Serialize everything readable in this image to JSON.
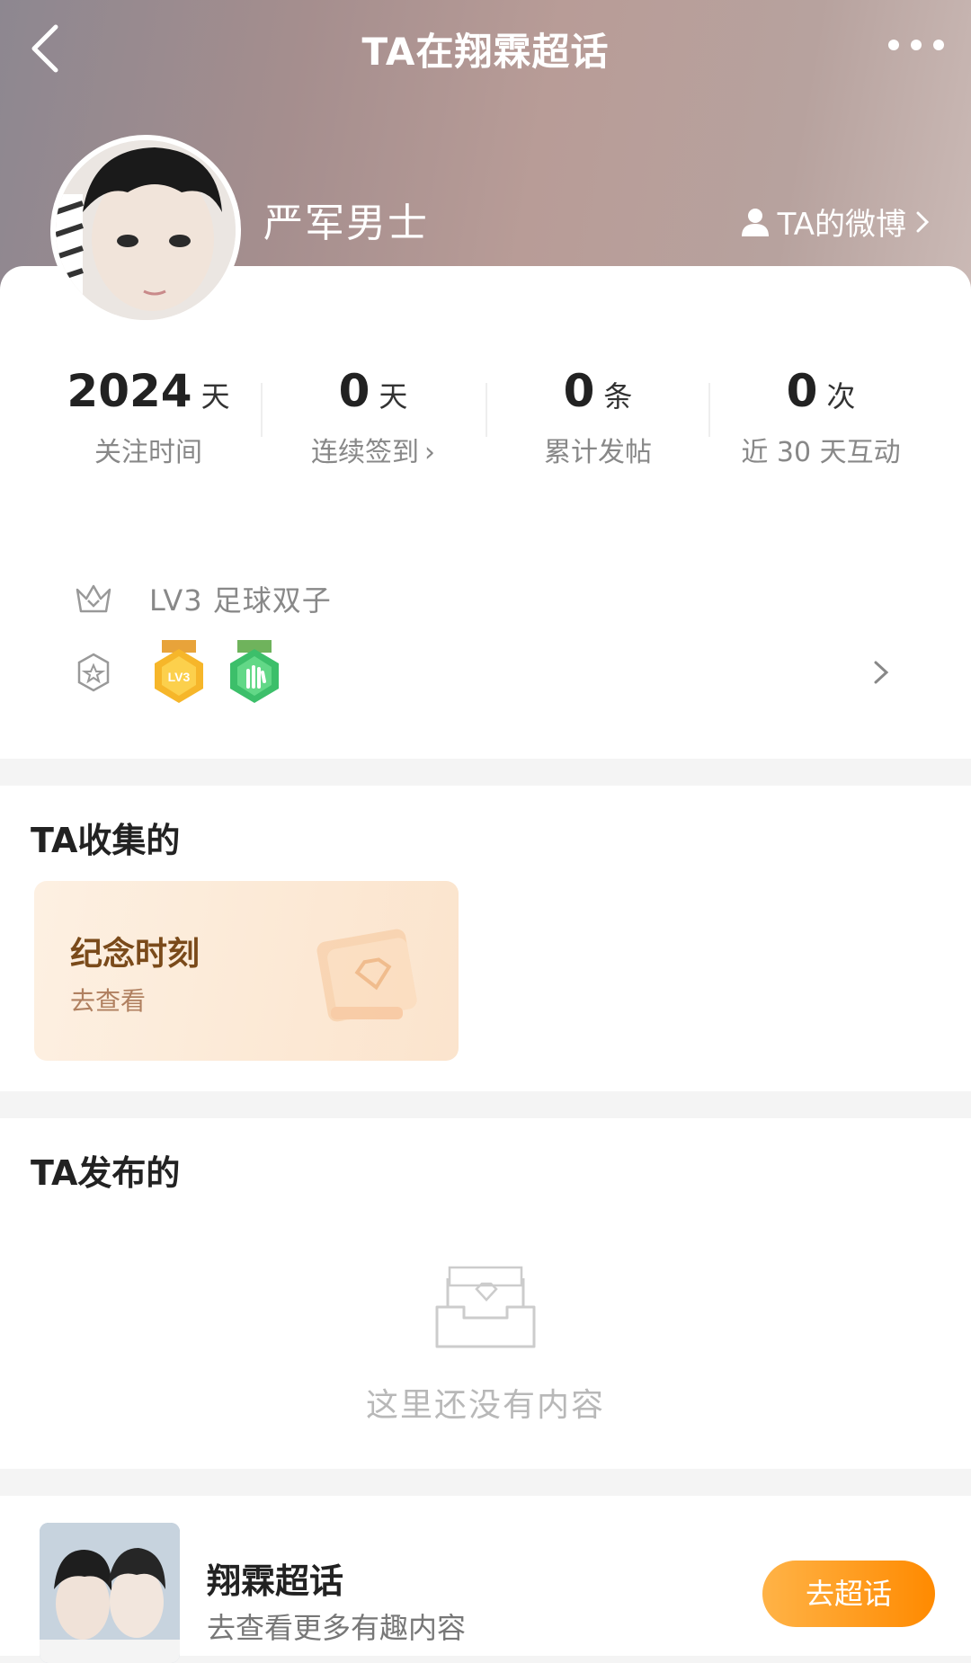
{
  "nav": {
    "title": "TA在翔霖超话"
  },
  "profile": {
    "username": "严军男士",
    "weibo_link": "TA的微博"
  },
  "stats": [
    {
      "value": "2024",
      "unit": "天",
      "label": "关注时间"
    },
    {
      "value": "0",
      "unit": "天",
      "label": "连续签到"
    },
    {
      "value": "0",
      "unit": "条",
      "label": "累计发帖"
    },
    {
      "value": "0",
      "unit": "次",
      "label": "近 30 天互动"
    }
  ],
  "level": {
    "text": "LV3 足球双子"
  },
  "medals": [
    {
      "name": "LV3",
      "color": "#f3a81c"
    },
    {
      "name": "hand",
      "color": "#3cbf6a"
    }
  ],
  "collected": {
    "title": "TA收集的",
    "card_title": "纪念时刻",
    "card_sub": "去查看"
  },
  "published": {
    "title": "TA发布的",
    "empty_text": "这里还没有内容"
  },
  "bottom": {
    "topic_name": "翔霖超话",
    "topic_sub": "去查看更多有趣内容",
    "button_label": "去超话"
  },
  "colors": {
    "accent": "#ff8a00",
    "header_gradient_start": "#8d8790",
    "header_gradient_end": "#cbbab6"
  }
}
